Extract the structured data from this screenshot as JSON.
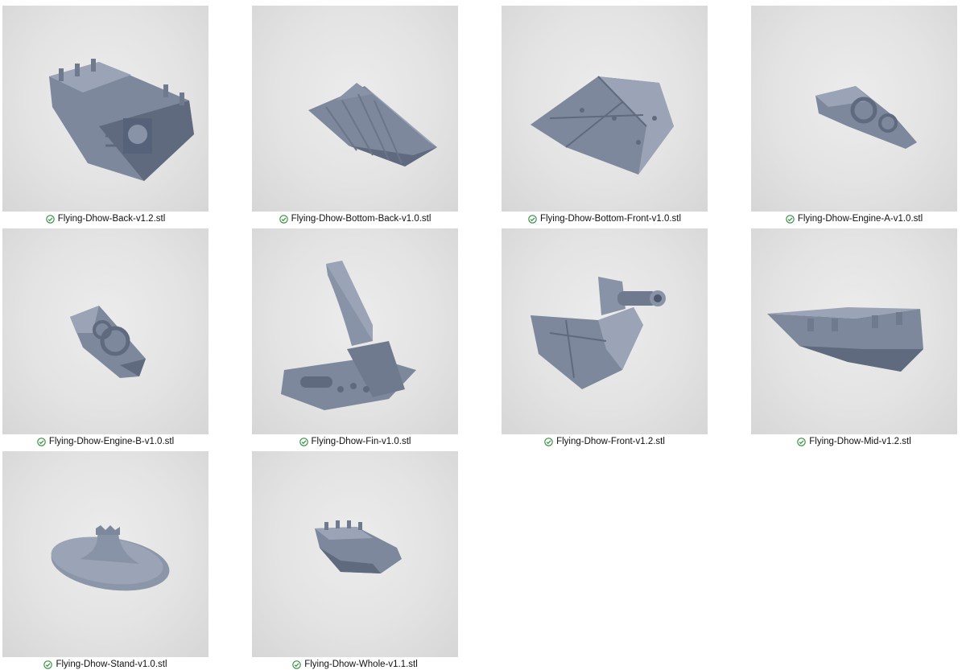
{
  "files": [
    {
      "name": "Flying-Dhow-Back-v1.2.stl",
      "status_icon": "synced-check-icon"
    },
    {
      "name": "Flying-Dhow-Bottom-Back-v1.0.stl",
      "status_icon": "synced-check-icon"
    },
    {
      "name": "Flying-Dhow-Bottom-Front-v1.0.stl",
      "status_icon": "synced-check-icon"
    },
    {
      "name": "Flying-Dhow-Engine-A-v1.0.stl",
      "status_icon": "synced-check-icon"
    },
    {
      "name": "Flying-Dhow-Engine-B-v1.0.stl",
      "status_icon": "synced-check-icon"
    },
    {
      "name": "Flying-Dhow-Fin-v1.0.stl",
      "status_icon": "synced-check-icon"
    },
    {
      "name": "Flying-Dhow-Front-v1.2.stl",
      "status_icon": "synced-check-icon"
    },
    {
      "name": "Flying-Dhow-Mid-v1.2.stl",
      "status_icon": "synced-check-icon"
    },
    {
      "name": "Flying-Dhow-Stand-v1.0.stl",
      "status_icon": "synced-check-icon"
    },
    {
      "name": "Flying-Dhow-Whole-v1.1.stl",
      "status_icon": "synced-check-icon"
    }
  ],
  "colors": {
    "model": "#7d889c",
    "model_dark": "#5f6a7e",
    "model_light": "#9aa4b6",
    "check": "#2e8b3a"
  }
}
